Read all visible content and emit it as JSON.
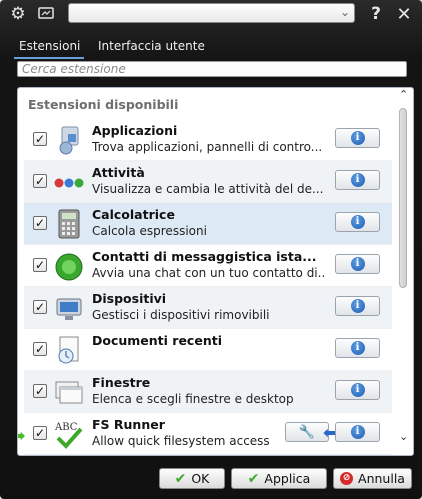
{
  "window": {
    "icons": [
      "gear-icon",
      "monitor-icon",
      "help-icon",
      "close-icon"
    ],
    "help_label": "?",
    "close_label": "✕"
  },
  "tabs": [
    {
      "label": "Estensioni"
    },
    {
      "label": "Interfaccia utente"
    }
  ],
  "search": {
    "placeholder": "Cerca estensione"
  },
  "list": {
    "header": "Estensioni disponibili",
    "items": [
      {
        "title": "Applicazioni",
        "desc": "Trova applicazioni, pannelli di contro...",
        "checked": true,
        "icon": "applications-icon"
      },
      {
        "title": "Attività",
        "desc": "Visualizza e cambia le attività del de...",
        "checked": true,
        "icon": "activities-icon"
      },
      {
        "title": "Calcolatrice",
        "desc": "Calcola espressioni",
        "checked": true,
        "icon": "calculator-icon"
      },
      {
        "title": "Contatti di messaggistica ista...",
        "desc": "Avvia una chat con un tuo contatto di...",
        "checked": true,
        "icon": "im-contacts-icon"
      },
      {
        "title": "Dispositivi",
        "desc": "Gestisci i dispositivi rimovibili",
        "checked": true,
        "icon": "devices-icon"
      },
      {
        "title": "Documenti recenti",
        "desc": "",
        "checked": true,
        "icon": "recent-documents-icon"
      },
      {
        "title": "Finestre",
        "desc": "Elenca e scegli finestre e desktop",
        "checked": true,
        "icon": "windows-icon"
      },
      {
        "title": "FS Runner",
        "desc": "Allow quick filesystem access",
        "checked": true,
        "icon": "fs-runner-icon"
      }
    ]
  },
  "buttons": {
    "ok": "OK",
    "apply": "Applica",
    "cancel": "Annulla"
  },
  "colors": {
    "accent": "#6a9fd8",
    "info": "#1e5fb5"
  }
}
